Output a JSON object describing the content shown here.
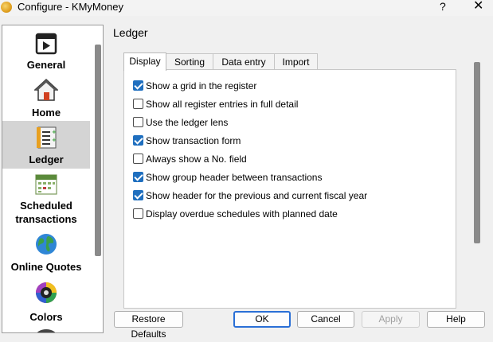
{
  "window": {
    "title": "Configure - KMyMoney",
    "help_glyph": "?",
    "close_glyph": "✕"
  },
  "sidebar": {
    "items": [
      {
        "label": "General",
        "icon": "general-icon"
      },
      {
        "label": "Home",
        "icon": "home-icon"
      },
      {
        "label": "Ledger",
        "icon": "ledger-icon",
        "selected": true
      },
      {
        "label_line1": "Scheduled",
        "label_line2": "transactions",
        "icon": "calendar-icon"
      },
      {
        "label": "Online Quotes",
        "icon": "globe-icon"
      },
      {
        "label": "Colors",
        "icon": "color-wheel-icon"
      }
    ]
  },
  "page": {
    "title": "Ledger",
    "tabs": [
      {
        "label": "Display",
        "active": true
      },
      {
        "label": "Sorting"
      },
      {
        "label": "Data entry"
      },
      {
        "label": "Import"
      }
    ],
    "options": [
      {
        "label": "Show a grid in the register",
        "checked": true
      },
      {
        "label": "Show all register entries in full detail",
        "checked": false
      },
      {
        "label": "Use the ledger lens",
        "checked": false
      },
      {
        "label": "Show transaction form",
        "checked": true
      },
      {
        "label": "Always show a No. field",
        "checked": false
      },
      {
        "label": "Show group header between transactions",
        "checked": true
      },
      {
        "label": "Show header for the previous and current fiscal year",
        "checked": true
      },
      {
        "label": "Display overdue schedules with planned date",
        "checked": false
      }
    ]
  },
  "buttons": {
    "restore_defaults": "Restore Defaults",
    "ok": "OK",
    "cancel": "Cancel",
    "apply": "Apply",
    "help": "Help"
  },
  "colors": {
    "accent": "#1f6fbf",
    "default_button_border": "#2a6fd6",
    "selected_item_bg": "#d4d4d4"
  }
}
